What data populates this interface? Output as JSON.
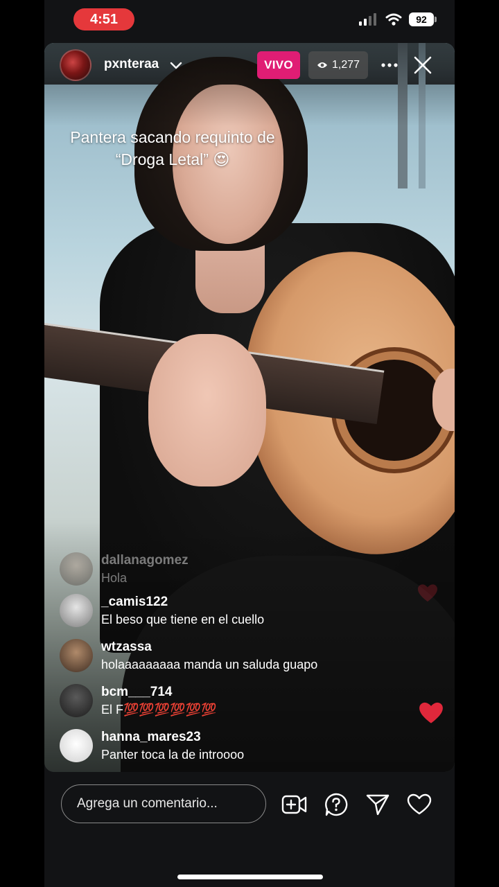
{
  "status_bar": {
    "time": "4:51",
    "battery": "92",
    "icons": [
      "cellular-signal-icon",
      "wifi-icon",
      "battery-icon"
    ]
  },
  "header": {
    "username": "pxnteraa",
    "live_label": "VIVO",
    "viewer_count": "1,277",
    "icons": [
      "chevron-down-icon",
      "eye-icon",
      "more-icon",
      "close-icon"
    ]
  },
  "caption": {
    "line1": "Pantera sacando requinto de",
    "line2": "“Droga Letal” 😍"
  },
  "comments": [
    {
      "user": "dallanagomez",
      "text": "Hola"
    },
    {
      "user": "_camis122",
      "text": "El beso que tiene en el cuello"
    },
    {
      "user": "wtzassa",
      "text": "holaaaaaaaaa manda un saluda guapo"
    },
    {
      "user": "bcm___714",
      "text": "El F💯💯💯💯💯💯"
    },
    {
      "user": "hanna_mares23",
      "text": "Panter toca la de introooo"
    }
  ],
  "footer": {
    "comment_placeholder": "Agrega un comentario...",
    "icons": [
      "add-video-icon",
      "question-icon",
      "send-icon",
      "heart-icon"
    ]
  },
  "colors": {
    "live_badge": "#e01d74",
    "time_pill": "#e5383b",
    "heart": "#e0283b"
  }
}
